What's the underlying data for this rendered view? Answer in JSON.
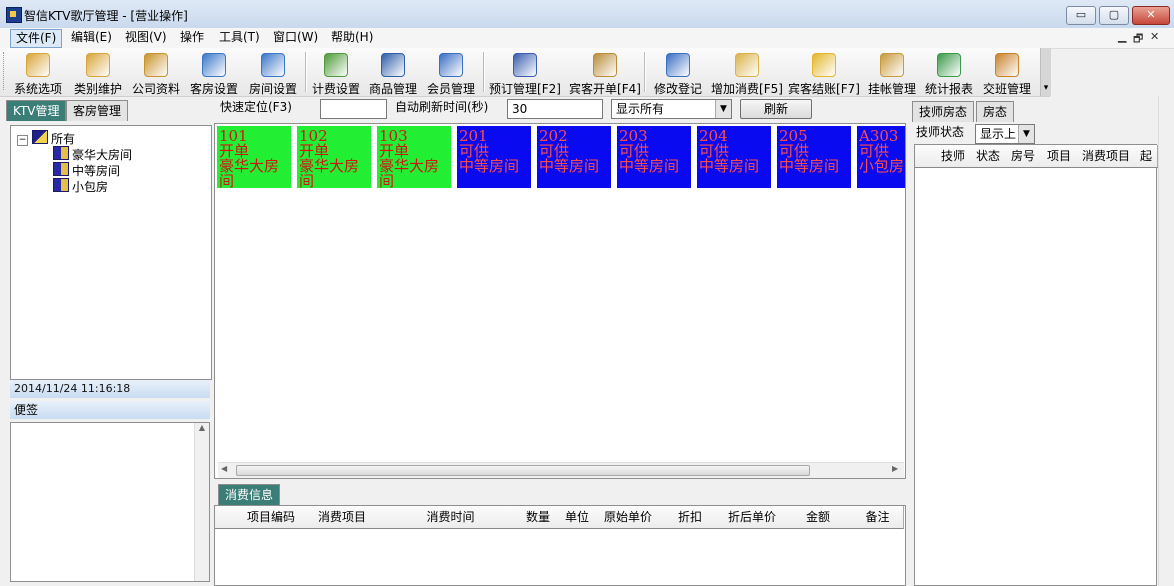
{
  "window": {
    "title": "智信KTV歌厅管理 - [营业操作]",
    "min": "▭",
    "max": "▢",
    "close": "✕"
  },
  "menu": [
    "文件(F)",
    "编辑(E)",
    "视图(V)",
    "操作",
    "工具(T)",
    "窗口(W)",
    "帮助(H)"
  ],
  "mdi_controls": [
    "▁",
    "🗗",
    "✕"
  ],
  "toolbar": [
    {
      "label": "系统选项",
      "icon": "hammer-icon",
      "color": "#d8a53a"
    },
    {
      "label": "类别维护",
      "icon": "hammer-icon",
      "color": "#d8a53a"
    },
    {
      "label": "公司资料",
      "icon": "phone-icon",
      "color": "#c9932c"
    },
    {
      "label": "客房设置",
      "icon": "building-icon",
      "color": "#3a77c9"
    },
    {
      "label": "房间设置",
      "icon": "building-icon",
      "color": "#3a77c9"
    },
    {
      "label": "计费设置",
      "icon": "money-icon",
      "color": "#4f9a3a"
    },
    {
      "label": "商品管理",
      "icon": "box-icon",
      "color": "#2f5fa8"
    },
    {
      "label": "会员管理",
      "icon": "user-icon",
      "color": "#3b6fc4"
    },
    {
      "label": "预订管理[F2]",
      "icon": "stapler-icon",
      "color": "#3a5fb0"
    },
    {
      "label": "宾客开单[F4]",
      "icon": "package-icon",
      "color": "#b98e3a"
    },
    {
      "label": "修改登记",
      "icon": "edit-user-icon",
      "color": "#3b6fc4"
    },
    {
      "label": "增加消费[F5]",
      "icon": "add-icon",
      "color": "#d9b34a"
    },
    {
      "label": "宾客结账[F7]",
      "icon": "coin-icon",
      "color": "#e3b62c"
    },
    {
      "label": "挂帐管理",
      "icon": "moneybag-icon",
      "color": "#c79a3c"
    },
    {
      "label": "统计报表",
      "icon": "chart-icon",
      "color": "#3a9a4a"
    },
    {
      "label": "交班管理",
      "icon": "users-icon",
      "color": "#c9822c"
    }
  ],
  "left_tabs": [
    "KTV管理",
    "客房管理"
  ],
  "tree": {
    "root": "所有",
    "children": [
      "豪华大房间",
      "中等房间",
      "小包房"
    ]
  },
  "datetime": "2014/11/24 11:16:18",
  "notes_label": "便签",
  "controls": {
    "quick_locate_label": "快速定位(F3)",
    "quick_locate_value": "",
    "auto_refresh_label": "自动刷新时间(秒)",
    "auto_refresh_value": "30",
    "display_filter": "显示所有",
    "refresh_button": "刷新"
  },
  "rooms": [
    {
      "number": "101",
      "status": "开单",
      "type": "豪华大房间",
      "state": "open"
    },
    {
      "number": "102",
      "status": "开单",
      "type": "豪华大房间",
      "state": "open"
    },
    {
      "number": "103",
      "status": "开单",
      "type": "豪华大房间",
      "state": "open"
    },
    {
      "number": "201",
      "status": "可供",
      "type": "中等房间",
      "state": "free"
    },
    {
      "number": "202",
      "status": "可供",
      "type": "中等房间",
      "state": "free"
    },
    {
      "number": "203",
      "status": "可供",
      "type": "中等房间",
      "state": "free"
    },
    {
      "number": "204",
      "status": "可供",
      "type": "中等房间",
      "state": "free"
    },
    {
      "number": "205",
      "status": "可供",
      "type": "中等房间",
      "state": "free"
    },
    {
      "number": "A303",
      "status": "可供",
      "type": "小包房",
      "state": "free"
    }
  ],
  "consume": {
    "tab": "消费信息",
    "columns": [
      "项目编码",
      "消费项目",
      "消费时间",
      "数量",
      "单位",
      "原始单价",
      "折扣",
      "折后单价",
      "金额",
      "备注"
    ]
  },
  "right": {
    "tabs": [
      "技师房态",
      "房态"
    ],
    "status_label": "技师状态",
    "status_value": "显示上",
    "columns": [
      "技师",
      "状态",
      "房号",
      "项目",
      "消费项目",
      "起"
    ]
  }
}
